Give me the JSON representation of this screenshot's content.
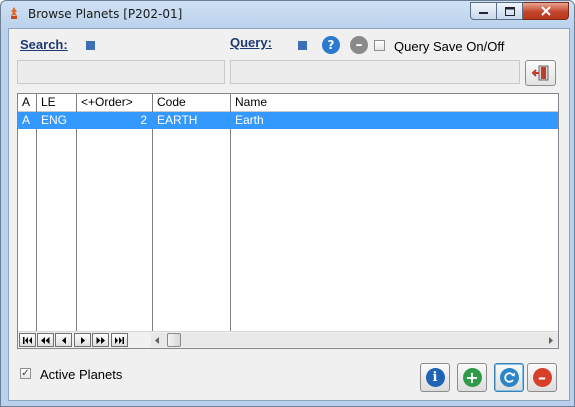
{
  "window": {
    "title": "Browse Planets [P202-01]"
  },
  "toolbar": {
    "search_label": "Search:",
    "query_label": "Query:",
    "query_save_label": "Query Save On/Off",
    "query_save_checked": false
  },
  "table": {
    "columns": [
      "A",
      "LE",
      "<+Order>",
      "Code",
      "Name"
    ],
    "rows": [
      {
        "a": "A",
        "le": "ENG",
        "order": "2",
        "code": "EARTH",
        "name": "Earth",
        "selected": true
      }
    ]
  },
  "footer": {
    "active_label": "Active Planets",
    "active_checked": true
  },
  "colors": {
    "selection": "#3399ff",
    "label_blue": "#1f3a73",
    "info": "#1f63b5",
    "add": "#2f9a4a",
    "refresh": "#2a86c9",
    "delete": "#d6402b"
  },
  "icons": [
    "app-icon",
    "help-icon",
    "remove-icon",
    "exit-icon",
    "info-icon",
    "add-icon",
    "refresh-icon",
    "delete-icon"
  ]
}
